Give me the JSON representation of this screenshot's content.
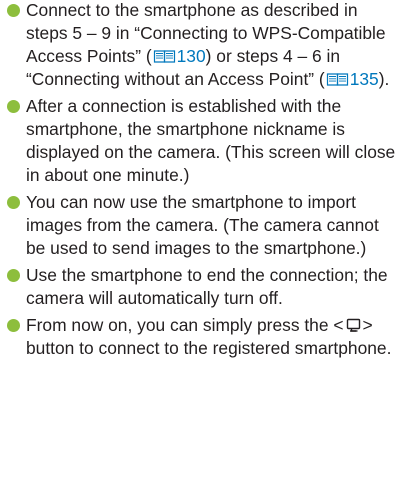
{
  "instructions": [
    {
      "t1": "Connect to the smartphone as described in steps 5 – 9 in “Connecting to WPS-Compatible Access Points” (",
      "page1": "130",
      "t2": ") or steps 4 – 6 in “Connecting without an Access Point” (",
      "page2": "135",
      "t3": ")."
    },
    {
      "text": "After a connection is established with the smartphone, the smartphone nickname is displayed on the camera. (This screen will close in about one minute.)"
    },
    {
      "text": "You can now use the smartphone to import images from the camera. (The camera cannot be used to send images to the smartphone.)"
    },
    {
      "text": "Use the smartphone to end the connection; the camera will automatically turn off."
    },
    {
      "t1": "From now on, you can simply press the <",
      "t2": "> button to connect to the registered smartphone."
    }
  ],
  "icons": {
    "bullet": "bullet-dot",
    "page_ref": "book-icon",
    "mobile_button": "mobile-device-button-icon"
  },
  "colors": {
    "text": "#231f20",
    "bullet": "#8dbe3d",
    "page_ref": "#0078bd"
  }
}
